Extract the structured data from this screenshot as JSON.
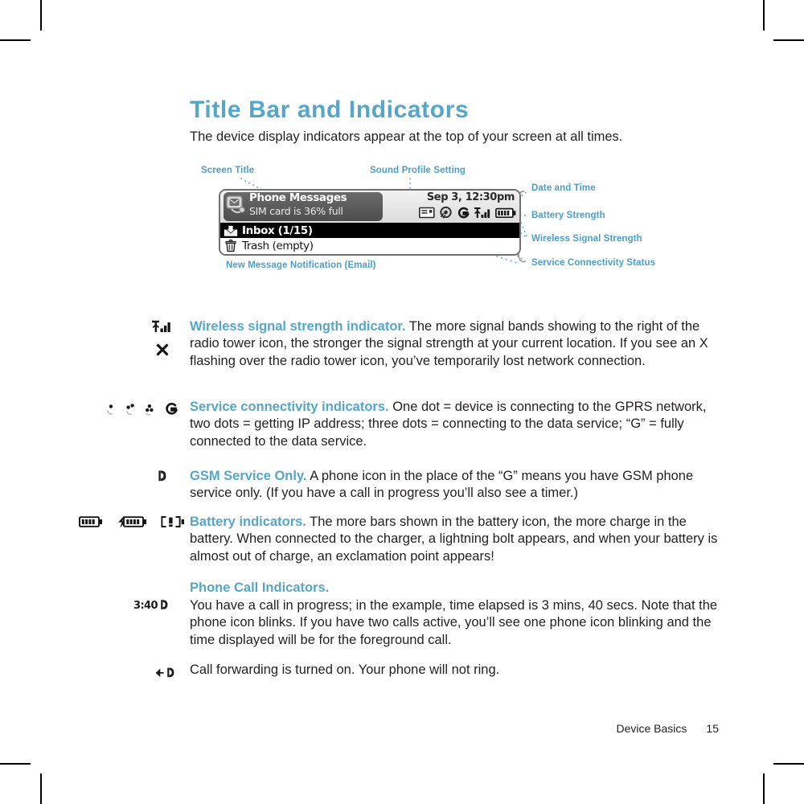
{
  "page": {
    "title": "Title Bar and Indicators",
    "intro": "The device display indicators appear at the top of your screen at all times."
  },
  "diagram": {
    "callouts": {
      "screen_title": "Screen Title",
      "sound_profile": "Sound Profile Setting",
      "new_message": "New Message Notification (Email)",
      "date_time": "Date and Time",
      "battery": "Battery Strength",
      "wireless": "Wireless Signal Strength",
      "service": "Service Connectivity Status"
    },
    "device_screen": {
      "title": "Phone Messages",
      "subtitle": "SIM card is 36% full",
      "datetime": "Sep 3, 12:30pm",
      "status_icons": [
        "envelope-icon",
        "sound-profile-icon",
        "gprs-g-icon",
        "signal-bars-icon",
        "battery-icon"
      ],
      "rows": [
        {
          "icon": "inbox-icon",
          "label": "Inbox (1/15)",
          "selected": true
        },
        {
          "icon": "trash-icon",
          "label": "Trash (empty)",
          "selected": false
        }
      ]
    }
  },
  "indicators": [
    {
      "icons": [
        "signal-bars-icon",
        "x-no-network-icon"
      ],
      "lead": "Wireless signal strength indicator.",
      "text": " The more signal bands showing to the right of the radio tower icon, the stronger the signal strength at your current location. If you see an X flashing over the radio tower icon, you’ve temporarily lost network connection."
    },
    {
      "icons": [
        "one-dot-icon",
        "two-dots-icon",
        "three-dots-icon",
        "gprs-g-icon"
      ],
      "lead": "Service connectivity indicators.",
      "text": " One dot = device is connecting to the GPRS network, two dots = getting IP address; three dots = connecting to the data service; “G” = fully connected to the data service."
    },
    {
      "icons": [
        "phone-handset-icon"
      ],
      "lead": "GSM Service Only.",
      "text": "  A phone icon in the place of the “G” means you have GSM phone service only. (If you have a call in progress you’ll also see a timer.)"
    },
    {
      "icons": [
        "battery-full-icon",
        "battery-charging-icon",
        "battery-low-icon"
      ],
      "lead": "Battery indicators.",
      "text": " The more bars shown in the battery icon, the more charge in the battery. When connected to the charger, a lightning bolt appears, and when your battery is almost out of charge, an exclamation point appears!"
    }
  ],
  "phone_call_section": {
    "heading": "Phone Call Indicators.",
    "call_timer_icon_label": "3:40",
    "call_in_progress_text": "You have a call in progress; in the example, time elapsed is 3 mins, 40 secs. Note that the phone icon blinks. If you have two calls active, you’ll see one phone icon blinking and the time displayed will be for the foreground call.",
    "call_forwarding_text": "Call forwarding is turned on. Your phone will not ring."
  },
  "footer": {
    "section": "Device Basics",
    "page_number": "15"
  },
  "colors": {
    "heading_blue": "#55a6c9",
    "callout_blue": "#4b9fcc",
    "body_black": "#231f20"
  }
}
